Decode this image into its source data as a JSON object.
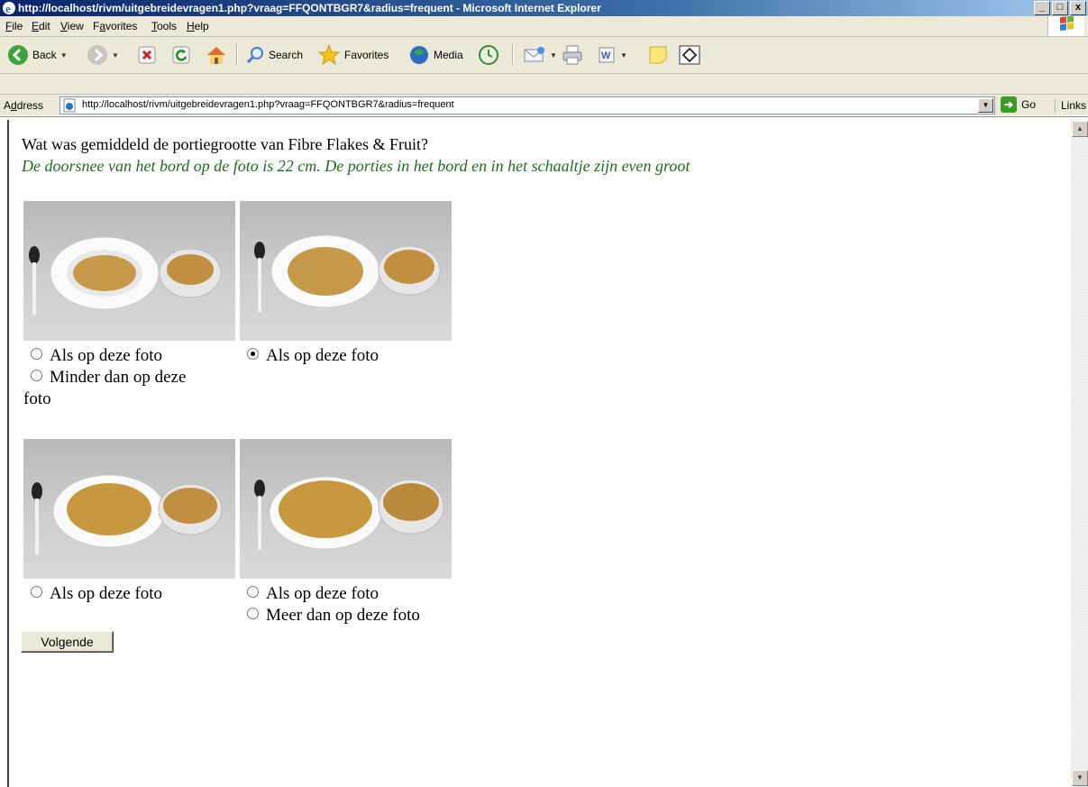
{
  "window": {
    "title": "http://localhost/rivm/uitgebreidevragen1.php?vraag=FFQONTBGR7&radius=frequent - Microsoft Internet Explorer",
    "controls": {
      "minimize": "_",
      "maximize": "Ő",
      "close": "x"
    }
  },
  "menu": {
    "items": [
      {
        "u": "F",
        "rest": "ile"
      },
      {
        "u": "E",
        "rest": "dit"
      },
      {
        "u": "V",
        "rest": "iew"
      },
      {
        "pre": "F",
        "u": "a",
        "rest": "vorites"
      },
      {
        "u": "T",
        "rest": "ools"
      },
      {
        "u": "H",
        "rest": "elp"
      }
    ]
  },
  "toolbar": {
    "back_label": "Back",
    "search_label": "Search",
    "favorites_label": "Favorites",
    "media_label": "Media"
  },
  "address": {
    "label_u": "d",
    "label_pre": "A",
    "label_rest": "dress",
    "url": "http://localhost/rivm/uitgebreidevragen1.php?vraag=FFQONTBGR7&radius=frequent",
    "go_label": "Go",
    "links_label": "Links"
  },
  "page": {
    "question": "Wat was gemiddeld de portiegrootte van Fibre Flakes & Fruit?",
    "hint": "De doorsnee van het bord op de foto is 22 cm. De porties in het bord en in het schaaltje zijn even groot",
    "photos": [
      {
        "options": [
          {
            "label": "Als op deze foto",
            "checked": false
          },
          {
            "label": "Minder dan op deze",
            "label2": "foto",
            "checked": false
          }
        ]
      },
      {
        "options": [
          {
            "label": "Als op deze foto",
            "checked": true
          }
        ]
      },
      {
        "options": [
          {
            "label": "Als op deze foto",
            "checked": false
          }
        ]
      },
      {
        "options": [
          {
            "label": "Als op deze foto",
            "checked": false
          },
          {
            "label": "Meer dan op deze foto",
            "checked": false
          }
        ]
      }
    ],
    "next_button": "Volgende"
  },
  "colors": {
    "titlebar": "#0a246a",
    "hint_text": "#1e6e1e",
    "chrome": "#ece9d8"
  }
}
